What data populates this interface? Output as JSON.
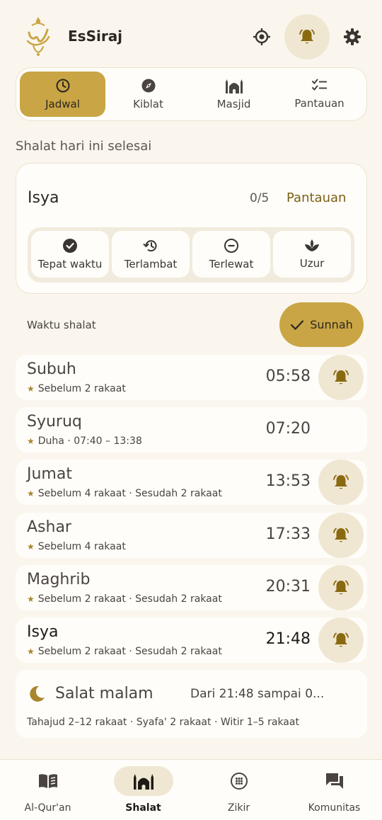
{
  "header": {
    "title": "EsSiraj",
    "icons": [
      "app-logo",
      "location-icon",
      "bell-icon",
      "gear-icon"
    ]
  },
  "tabs": [
    {
      "label": "Jadwal",
      "icon": "clock-icon",
      "active": true
    },
    {
      "label": "Kiblat",
      "icon": "compass-icon",
      "active": false
    },
    {
      "label": "Masjid",
      "icon": "mosque-icon",
      "active": false
    },
    {
      "label": "Pantauan",
      "icon": "checklist-icon",
      "active": false
    }
  ],
  "status_text": "Shalat hari ini selesai",
  "current": {
    "name": "Isya",
    "count": "0/5",
    "link": "Pantauan",
    "options": [
      {
        "label": "Tepat waktu",
        "icon": "check-circle-icon"
      },
      {
        "label": "Terlambat",
        "icon": "history-icon"
      },
      {
        "label": "Terlewat",
        "icon": "minus-circle-icon"
      },
      {
        "label": "Uzur",
        "icon": "leaf-icon"
      }
    ]
  },
  "waktu": {
    "label": "Waktu shalat",
    "sunnah_label": "Sunnah"
  },
  "prayers": [
    {
      "name": "Subuh",
      "note": "Sebelum 2 rakaat",
      "time": "05:58",
      "bell": true
    },
    {
      "name": "Syuruq",
      "note": "Duha · 07:40 – 13:38",
      "time": "07:20",
      "bell": false
    },
    {
      "name": "Jumat",
      "note": "Sebelum 4 rakaat · Sesudah 2 rakaat",
      "time": "13:53",
      "bell": true
    },
    {
      "name": "Ashar",
      "note": "Sebelum 4 rakaat",
      "time": "17:33",
      "bell": true
    },
    {
      "name": "Maghrib",
      "note": "Sebelum 2 rakaat · Sesudah 2 rakaat",
      "time": "20:31",
      "bell": true
    },
    {
      "name": "Isya",
      "note": "Sebelum 2 rakaat · Sesudah 2 rakaat",
      "time": "21:48",
      "bell": true
    }
  ],
  "night": {
    "title": "Salat malam",
    "range": "Dari 21:48 sampai 0...",
    "detail": "Tahajud 2–12 rakaat · Syafa' 2 rakaat · Witir 1–5 rakaat"
  },
  "bottom_nav": [
    {
      "label": "Al-Qur'an",
      "icon": "book-icon",
      "active": false
    },
    {
      "label": "Shalat",
      "icon": "mosque-icon",
      "active": true
    },
    {
      "label": "Zikir",
      "icon": "prayer-beads-icon",
      "active": false
    },
    {
      "label": "Komunitas",
      "icon": "chat-icon",
      "active": false
    }
  ],
  "colors": {
    "background": "#faf6ee",
    "accent": "#c9a545",
    "accent_soft": "#f0e7d3",
    "text": "#3a3530",
    "icon_gold": "#a9862e"
  }
}
